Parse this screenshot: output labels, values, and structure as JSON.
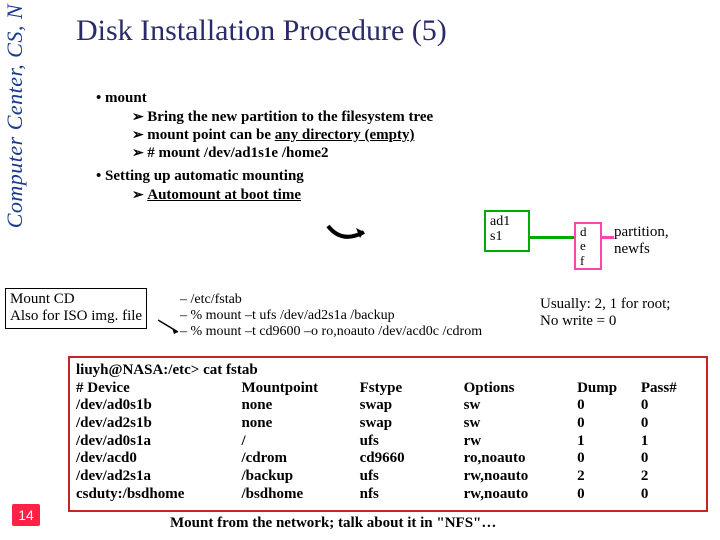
{
  "page": {
    "number": "14",
    "sidebar": "Computer Center, CS, N"
  },
  "title": "Disk Installation Procedure (5)",
  "bullets": {
    "mount": "mount",
    "sub1a": "Bring the new partition to the filesystem tree",
    "sub1b_pre": "mount point can be ",
    "sub1b_ul": "any directory (empty)",
    "sub1c": "# mount /dev/ad1s1e /home2",
    "setting": "Setting up automatic mounting",
    "sub2a": "Automount at boot time"
  },
  "disk": {
    "l1": "ad1",
    "l2": "s1"
  },
  "parts": {
    "a": "d",
    "b": "e",
    "c": "f"
  },
  "caption1": {
    "l1": "partition,",
    "l2": "newfs"
  },
  "mountcd": {
    "l1": "Mount CD",
    "l2": "Also for ISO img. file"
  },
  "dash": {
    "a": "/etc/fstab",
    "b": "% mount –t ufs /dev/ad2s1a /backup",
    "c": "% mount –t cd9600 –o ro,noauto /dev/acd0c /cdrom"
  },
  "usually": {
    "l1": "Usually: 2, 1 for root;",
    "l2": "No write = 0"
  },
  "fstab": {
    "prompt": "liuyh@NASA:/etc> cat fstab",
    "hdr": {
      "c1": "# Device",
      "c2": "Mountpoint",
      "c3": "Fstype",
      "c4": "Options",
      "c5": "Dump",
      "c6": "Pass#"
    },
    "r1": {
      "c1": "/dev/ad0s1b",
      "c2": "none",
      "c3": "swap",
      "c4": "sw",
      "c5": "0",
      "c6": "0"
    },
    "r2": {
      "c1": "/dev/ad2s1b",
      "c2": "none",
      "c3": "swap",
      "c4": "sw",
      "c5": "0",
      "c6": "0"
    },
    "r3": {
      "c1": "/dev/ad0s1a",
      "c2": "/",
      "c3": "ufs",
      "c4": "rw",
      "c5": "1",
      "c6": "1"
    },
    "r4": {
      "c1": "/dev/acd0",
      "c2": "/cdrom",
      "c3": "cd9660",
      "c4": "ro,noauto",
      "c5": "0",
      "c6": "0"
    },
    "r5": {
      "c1": "/dev/ad2s1a",
      "c2": "/backup",
      "c3": "ufs",
      "c4": "rw,noauto",
      "c5": "2",
      "c6": "2"
    },
    "r6": {
      "c1": "csduty:/bsdhome",
      "c2": "/bsdhome",
      "c3": "nfs",
      "c4": "rw,noauto",
      "c5": "0",
      "c6": "0"
    }
  },
  "footer": "Mount from the network; talk about it in \"NFS\"…"
}
